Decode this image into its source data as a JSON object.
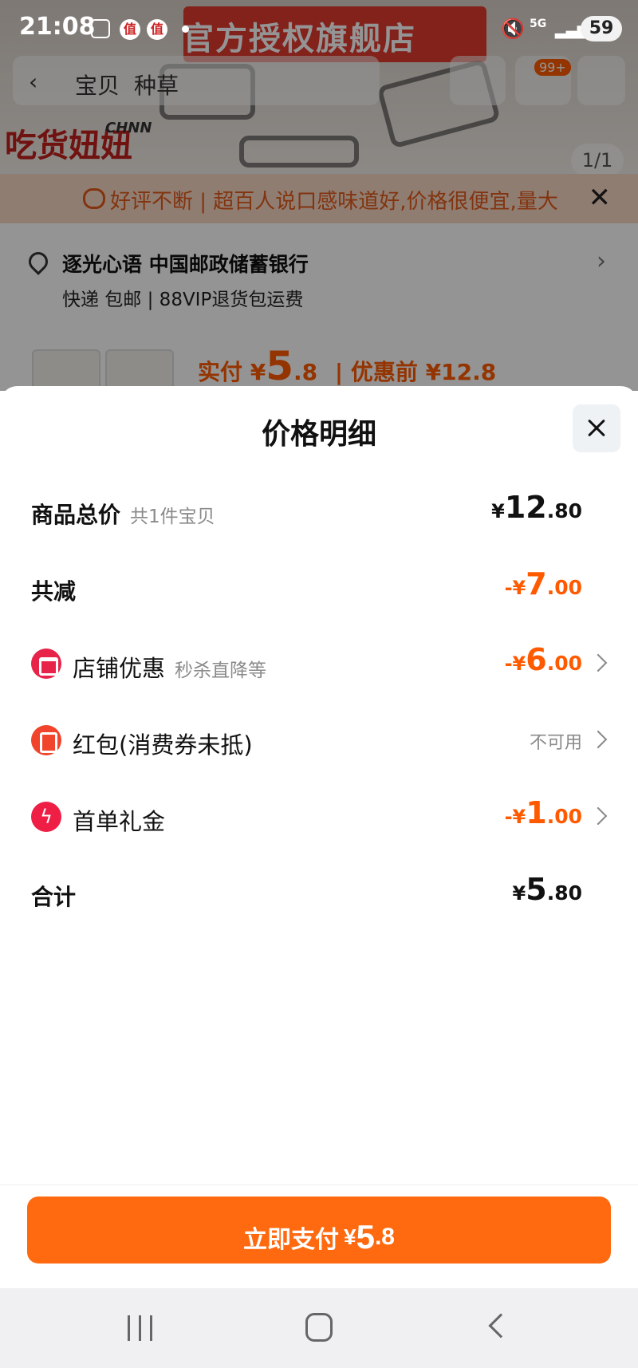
{
  "status_bar": {
    "time": "21:08",
    "notif_label": "值",
    "network": "5G",
    "battery": "59"
  },
  "background_page": {
    "shop_banner": "官方授权旗舰店",
    "brand_logo": "吃货妞妞",
    "brand_logo_sub": "CHNN",
    "tab_label": "宝贝",
    "tab_label_2": "种草",
    "cart_badge": "99+",
    "image_counter": "1/1",
    "review_text": "好评不断 | 超百人说口感味道好,价格很便宜,量大",
    "address": "逐光心语 中国邮政储蓄银行",
    "shipping": "快递 包邮 | 88VIP退货包运费",
    "pay_prefix": "实付 ¥",
    "pay_int": "5",
    "pay_dec": ".8",
    "pay_before": "| 优惠前 ¥12.8"
  },
  "sheet": {
    "title": "价格明细",
    "rows": [
      {
        "label": "商品总价",
        "sub": "共1件宝贝",
        "sym": "¥",
        "int": "12",
        "dec": ".80"
      },
      {
        "label": "共减",
        "sym": "-¥",
        "int": "7",
        "dec": ".00"
      },
      {
        "label": "店铺优惠",
        "sub": "秒杀直降等",
        "sym": "-¥",
        "int": "6",
        "dec": ".00"
      },
      {
        "label": "红包(消费券未抵)",
        "status": "不可用"
      },
      {
        "label": "首单礼金",
        "sym": "-¥",
        "int": "1",
        "dec": ".00"
      },
      {
        "label": "合计",
        "sym": "¥",
        "int": "5",
        "dec": ".80"
      }
    ]
  },
  "pay_button": {
    "label": "立即支付",
    "sym": "¥",
    "int": "5",
    "dec": ".8"
  },
  "colors": {
    "accent": "#ff6a10",
    "discount": "#ff5a00",
    "icon_red": "#e8234a"
  }
}
